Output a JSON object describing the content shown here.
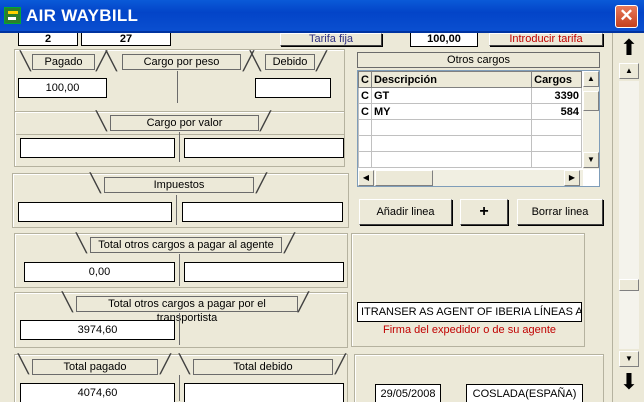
{
  "window": {
    "title": "AIR WAYBILL",
    "close_symbol": "✕"
  },
  "top_row": {
    "field1": "2",
    "field2": "27",
    "tarifa_fija": "Tarifa fija",
    "tarifa_value": "100,00",
    "introducir_tarifa": "Introducir tarifa"
  },
  "pesos": {
    "pagado_tab": "Pagado",
    "cargo_peso_tab": "Cargo por peso",
    "debido_tab": "Debido",
    "pagado_value": "100,00",
    "debido_value": ""
  },
  "valor": {
    "tab": "Cargo  por valor",
    "left_value": "",
    "right_value": ""
  },
  "impuestos": {
    "tab": "Impuestos",
    "left_value": "",
    "right_value": ""
  },
  "otros_cargos": {
    "header": "Otros cargos",
    "columns": [
      "C",
      "Descripción",
      "Cargos"
    ],
    "rows": [
      {
        "c": "C",
        "desc": "GT",
        "cargos": "3390"
      },
      {
        "c": "C",
        "desc": "MY",
        "cargos": "584"
      }
    ],
    "add_line": "Añadir linea",
    "plus": "+",
    "delete_line": "Borrar linea"
  },
  "agente": {
    "tab": "Total otros cargos a pagar al agente",
    "left_value": "0,00",
    "right_value": ""
  },
  "transportista": {
    "tab": "Total otros cargos a pagar por el transportista",
    "left_value": "3974,60"
  },
  "firma": {
    "agent_text": "ITRANSER AS AGENT OF IBERIA LÍNEAS A",
    "label": "Firma del expedidor o de su agente"
  },
  "totales": {
    "pagado_tab": "Total pagado",
    "debido_tab": "Total debido",
    "pagado_value": "4074,60",
    "debido_value": ""
  },
  "bottom_right": {
    "date": "29/05/2008",
    "place": "COSLADA(ESPAÑA)"
  },
  "accent_colors": {
    "title_bar": "#0a5ad8",
    "close": "#c4401e",
    "red_text": "#c00000"
  },
  "icons": {
    "scroll_up": "▲",
    "scroll_down": "▼",
    "grid_left": "◀",
    "grid_right": "▶",
    "page_up": "⬆",
    "page_down": "⬇"
  }
}
